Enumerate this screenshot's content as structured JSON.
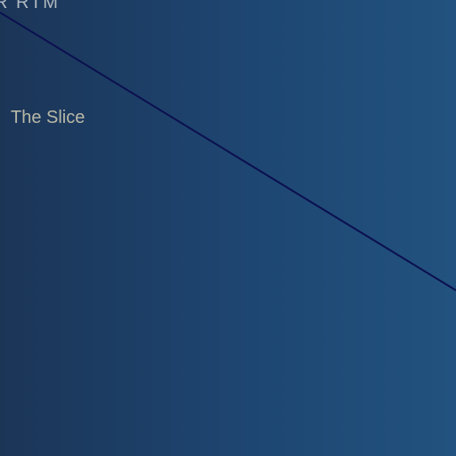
{
  "header": {
    "fragment_text": "R  RTM"
  },
  "main": {
    "slice_label": "The Slice"
  },
  "colors": {
    "background_left": "#1b3557",
    "background_right": "#22527f",
    "divider_line": "#0b0f4f",
    "label_text": "#b9b8a7",
    "fragment_text": "#b9bfc6"
  }
}
